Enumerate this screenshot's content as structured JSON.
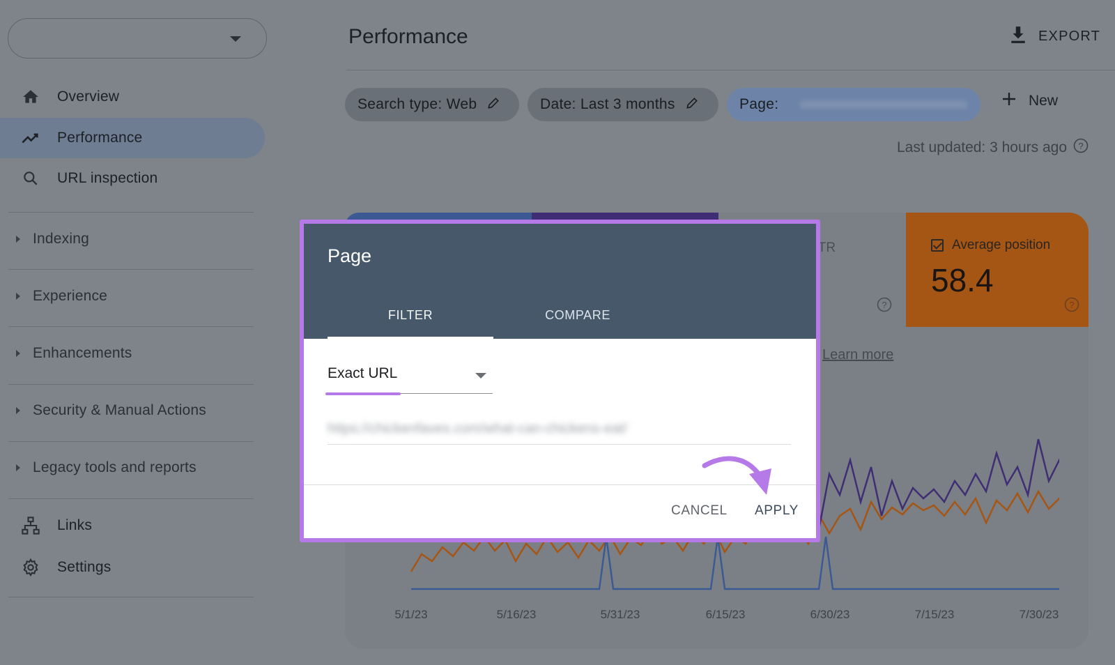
{
  "sidebar": {
    "nav_top": [
      {
        "label": "Overview",
        "icon": "home-icon"
      },
      {
        "label": "Performance",
        "icon": "trending-up-icon",
        "active": true
      },
      {
        "label": "URL inspection",
        "icon": "search-icon"
      }
    ],
    "sections": [
      "Indexing",
      "Experience",
      "Enhancements",
      "Security & Manual Actions",
      "Legacy tools and reports"
    ],
    "nav_bottom": [
      {
        "label": "Links",
        "icon": "sitemap-icon"
      },
      {
        "label": "Settings",
        "icon": "gear-icon"
      }
    ]
  },
  "header": {
    "title": "Performance",
    "export_label": "EXPORT"
  },
  "filters": {
    "search_type": "Search type: Web",
    "date": "Date: Last 3 months",
    "page": "Page:",
    "new_label": "New",
    "last_updated": "Last updated: 3 hours ago"
  },
  "metrics": {
    "ctr_label": "CTR",
    "avg_position_label": "Average position",
    "avg_position_value": "58.4",
    "learn_more": "Learn more"
  },
  "chart_data": {
    "type": "line",
    "x_tick_labels": [
      "5/1/23",
      "5/16/23",
      "5/31/23",
      "6/15/23",
      "6/30/23",
      "7/15/23",
      "7/30/23"
    ],
    "series_colors": [
      "#3b5a94",
      "#3f2e73",
      "#a55614"
    ]
  },
  "dialog": {
    "title": "Page",
    "tabs": [
      "FILTER",
      "COMPARE"
    ],
    "active_tab": "FILTER",
    "match_type": "Exact URL",
    "url_value": "https://chickenfaves.com/what-can-chickens-eat/",
    "cancel_label": "CANCEL",
    "apply_label": "APPLY"
  },
  "colors": {
    "accent_highlight": "#b57ae8",
    "dialog_header": "#46586a",
    "avg_position_tile": "#a55614"
  }
}
